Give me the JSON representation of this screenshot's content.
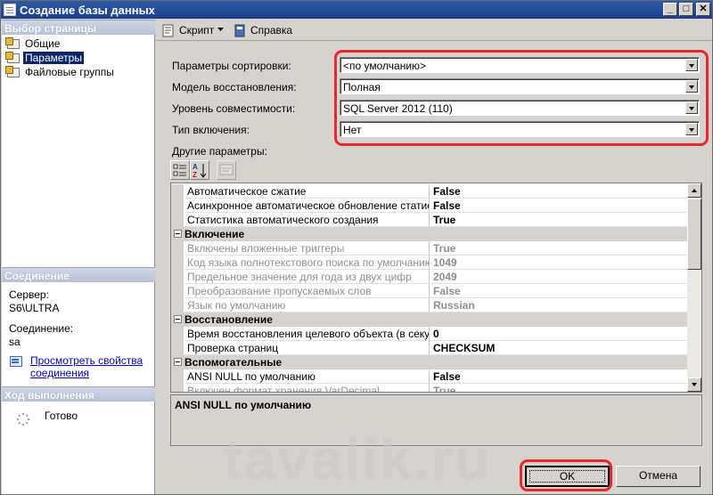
{
  "window": {
    "title": "Создание базы данных",
    "buttons": {
      "minimize": "_",
      "maximize": "□",
      "close": "✕"
    }
  },
  "sidebar": {
    "header": "Выбор страницы",
    "items": [
      {
        "label": "Общие",
        "selected": false
      },
      {
        "label": "Параметры",
        "selected": true
      },
      {
        "label": "Файловые группы",
        "selected": false
      }
    ],
    "connection": {
      "header": "Соединение",
      "server_label": "Сервер:",
      "server_value": "S6\\ULTRA",
      "connection_label": "Соединение:",
      "connection_value": "sa",
      "link_line1": "Просмотреть свойства",
      "link_line2": "соединения"
    },
    "progress": {
      "header": "Ход выполнения",
      "status": "Готово"
    }
  },
  "toolbar": {
    "script_label": "Скрипт",
    "help_label": "Справка"
  },
  "form": {
    "fields": [
      {
        "label": "Параметры сортировки:",
        "value": "<по умолчанию>"
      },
      {
        "label": "Модель восстановления:",
        "value": "Полная"
      },
      {
        "label": "Уровень совместимости:",
        "value": "SQL Server 2012 (110)"
      },
      {
        "label": "Тип включения:",
        "value": "Нет"
      }
    ],
    "other_label": "Другие параметры:"
  },
  "properties": {
    "rows": [
      {
        "type": "prop",
        "name": "Автоматическое сжатие",
        "value": "False",
        "disabled": false
      },
      {
        "type": "prop",
        "name": "Асинхронное автоматическое обновление статистики",
        "value": "False",
        "disabled": false
      },
      {
        "type": "prop",
        "name": "Статистика автоматического создания",
        "value": "True",
        "disabled": false
      },
      {
        "type": "cat",
        "name": "Включение"
      },
      {
        "type": "prop",
        "name": "Включены вложенные триггеры",
        "value": "True",
        "disabled": true
      },
      {
        "type": "prop",
        "name": "Код языка полнотекстового поиска по умолчанию",
        "value": "1049",
        "disabled": true
      },
      {
        "type": "prop",
        "name": "Предельное значение для года из двух цифр",
        "value": "2049",
        "disabled": true
      },
      {
        "type": "prop",
        "name": "Преобразование пропускаемых слов",
        "value": "False",
        "disabled": true
      },
      {
        "type": "prop",
        "name": "Язык по умолчанию",
        "value": "Russian",
        "disabled": true
      },
      {
        "type": "cat",
        "name": "Восстановление"
      },
      {
        "type": "prop",
        "name": "Время восстановления целевого объекта (в секундах)",
        "value": "0",
        "disabled": false
      },
      {
        "type": "prop",
        "name": "Проверка страниц",
        "value": "CHECKSUM",
        "disabled": false
      },
      {
        "type": "cat",
        "name": "Вспомогательные"
      },
      {
        "type": "prop",
        "name": "ANSI NULL по умолчанию",
        "value": "False",
        "disabled": false
      },
      {
        "type": "prop",
        "name": "Включен формат хранения VarDecimal",
        "value": "True",
        "disabled": true
      }
    ],
    "description_title": "ANSI NULL по умолчанию"
  },
  "buttons": {
    "ok": "OK",
    "cancel": "Отмена"
  },
  "watermark": "tavalik.ru",
  "colors": {
    "highlight": "#e8262b",
    "selection": "#0a246a",
    "titlebar": "#1b3f8a"
  }
}
